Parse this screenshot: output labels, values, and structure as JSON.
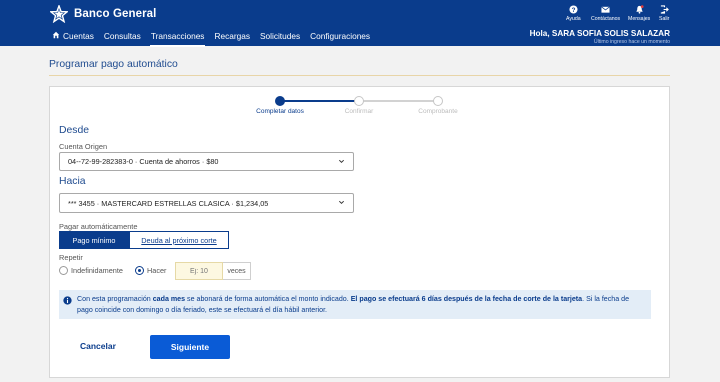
{
  "header": {
    "brand": "Banco General",
    "nav": [
      {
        "label": "Cuentas",
        "icon": "home-icon"
      },
      {
        "label": "Consultas"
      },
      {
        "label": "Transacciones",
        "active": true
      },
      {
        "label": "Recargas"
      },
      {
        "label": "Solicitudes"
      },
      {
        "label": "Configuraciones"
      }
    ],
    "utility": [
      {
        "label": "Ayuda",
        "icon": "help-icon"
      },
      {
        "label": "Contáctanos",
        "icon": "mail-icon"
      },
      {
        "label": "Mensajes",
        "icon": "bell-icon"
      },
      {
        "label": "Salir",
        "icon": "logout-icon"
      }
    ],
    "greeting": "Hola, SARA SOFIA SOLIS SALAZAR",
    "last_login": "Último ingreso hace un momento"
  },
  "page": {
    "title": "Programar pago automático"
  },
  "stepper": {
    "steps": [
      "Completar datos",
      "Confirmar",
      "Comprobante"
    ],
    "current_index": 0
  },
  "form": {
    "from_heading": "Desde",
    "origin_label": "Cuenta Origen",
    "origin_value": "04--72-99-282383-0 · Cuenta de ahorros · $80",
    "to_heading": "Hacia",
    "destination_value": "*** 3455 · MASTERCARD ESTRELLAS CLASICA · $1,234,05",
    "pay_label": "Pagar automáticamente",
    "pay_options": [
      "Pago mínimo",
      "Deuda al próximo corte"
    ],
    "pay_selected": "Pago mínimo",
    "repeat_label": "Repetir",
    "repeat_options": [
      "Indefinidamente",
      "Hacer"
    ],
    "repeat_selected": "Hacer",
    "count_placeholder": "Ej: 10",
    "count_unit": "veces"
  },
  "info": {
    "part1": "Con esta programación ",
    "part2": "cada mes",
    "part3": " se abonará de forma automática el monto indicado. ",
    "part4": "El pago se efectuará 6 días después de la fecha de corte de la tarjeta",
    "part5": ". Si la fecha de pago coincide con domingo o día feriado, este se efectuará el día hábil anterior."
  },
  "actions": {
    "cancel": "Cancelar",
    "next": "Siguiente"
  },
  "colors": {
    "primary": "#0a3c8c",
    "button": "#0a5bd6",
    "info_bg": "#e3edf7"
  }
}
